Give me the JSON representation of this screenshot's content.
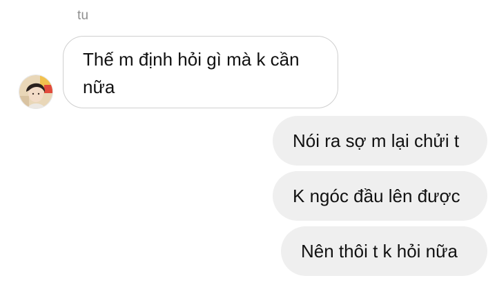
{
  "conversation": {
    "sender_name": "tu",
    "avatar_icon": "profile-photo",
    "incoming_message": {
      "text": "Thế m định hỏi gì mà k cần nữa"
    },
    "outgoing_messages": [
      {
        "text": "Nói ra sợ m lại chửi t"
      },
      {
        "text": "K ngóc đầu lên được"
      },
      {
        "text": "Nên thôi t k hỏi nữa"
      }
    ]
  },
  "colors": {
    "incoming_border": "#cfcfcf",
    "outgoing_bg": "#efefef",
    "name_text": "#8e8e8e"
  }
}
